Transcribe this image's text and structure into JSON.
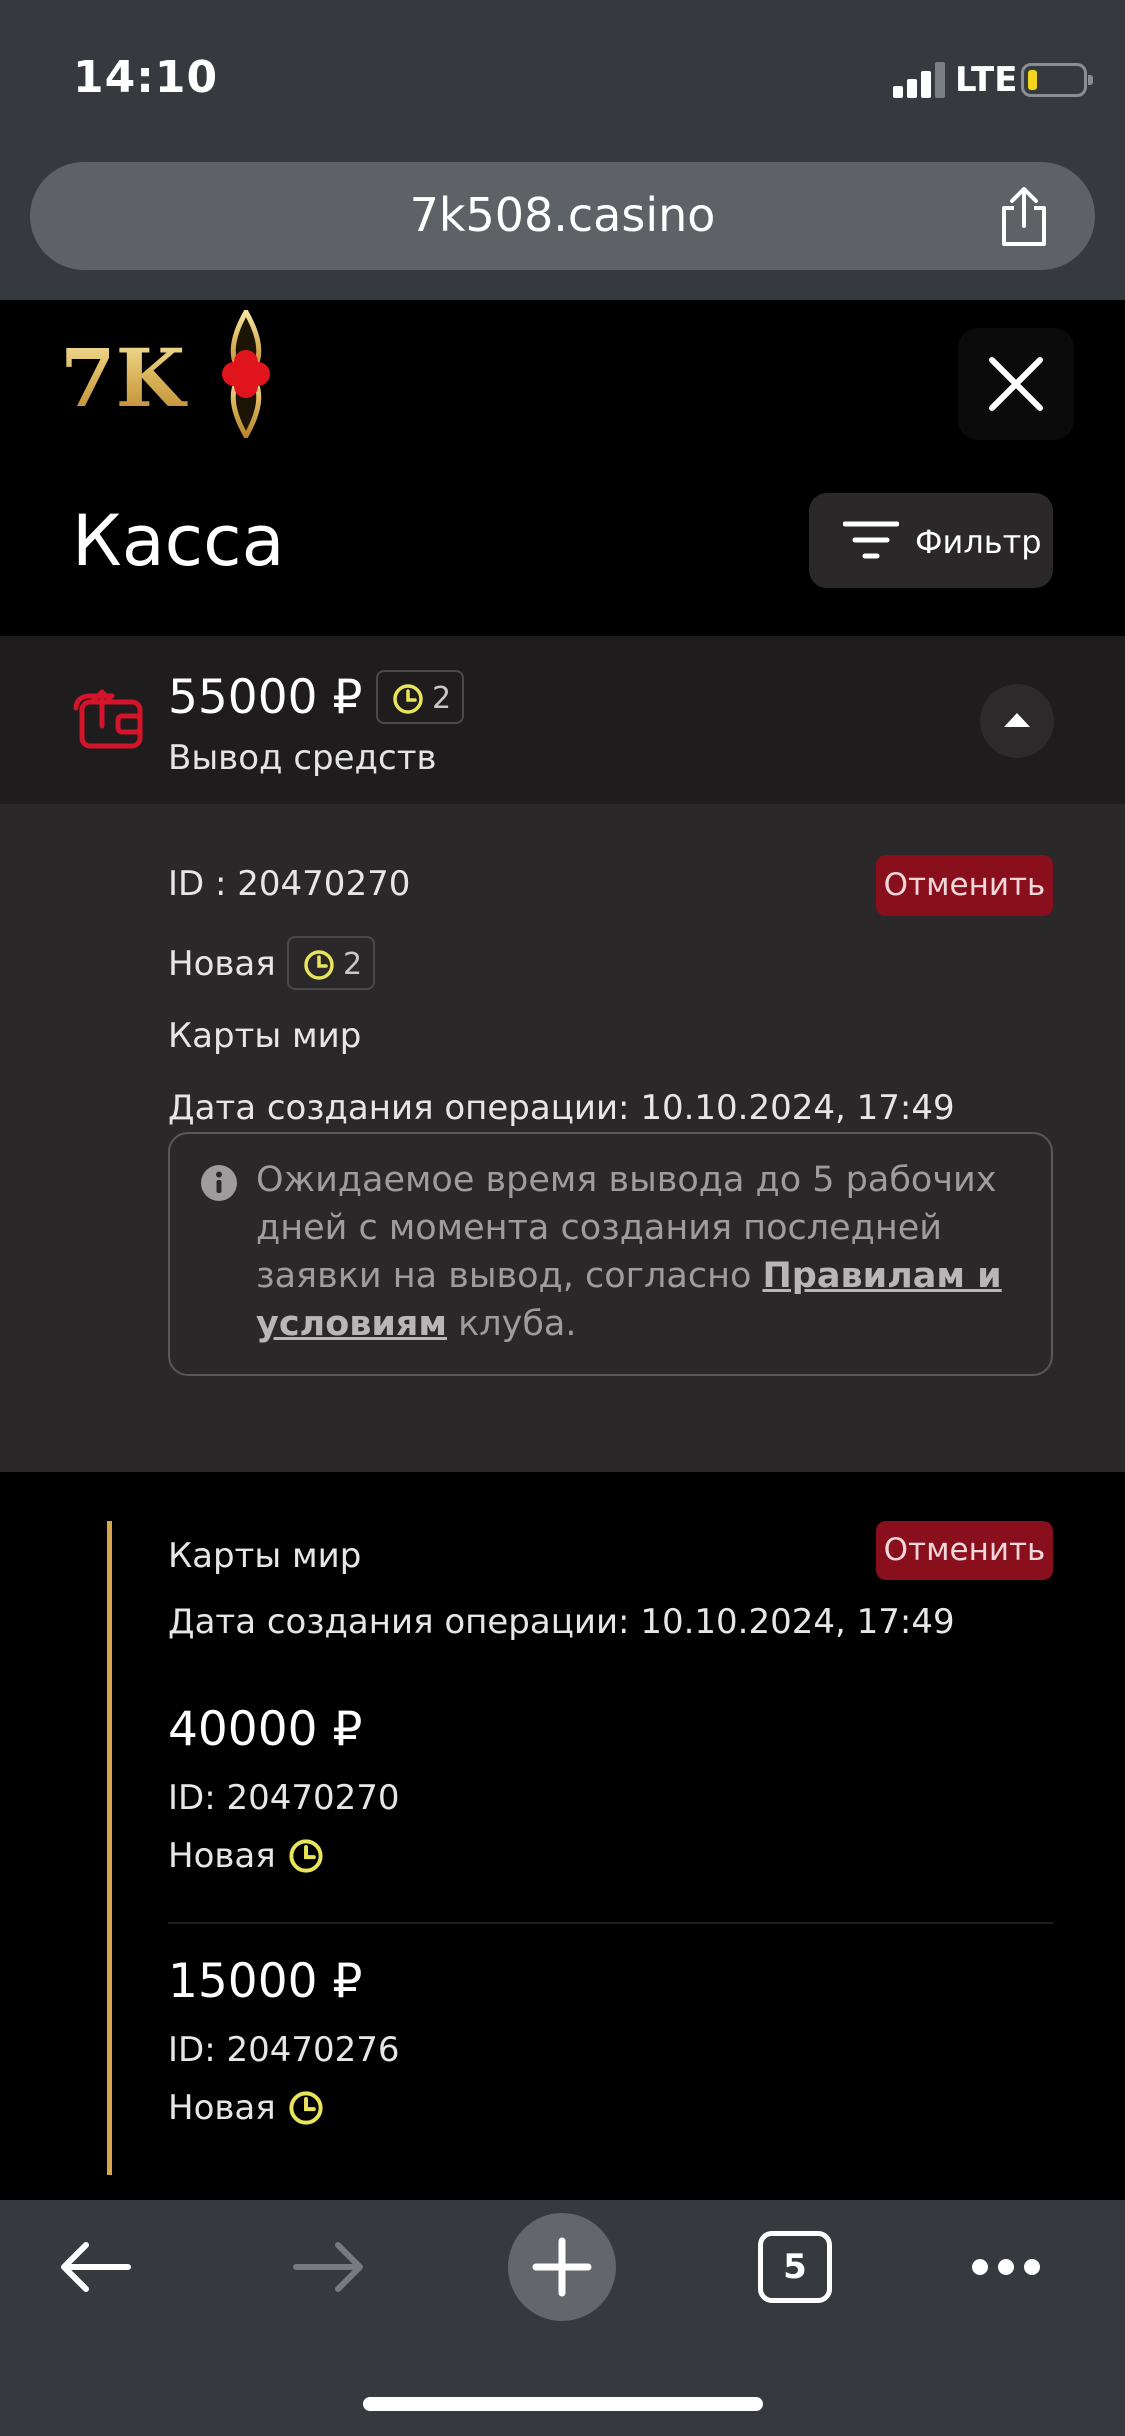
{
  "status_bar": {
    "time": "14:10",
    "network": "LTE"
  },
  "browser": {
    "url": "7k508.casino",
    "tabs_count": "5"
  },
  "header": {
    "logo_text": "7K",
    "title": "Касса",
    "filter_label": "Фильтр"
  },
  "transaction": {
    "amount": "55000 ₽",
    "pending_count": "2",
    "type": "Вывод средств",
    "details": {
      "id": "ID : 20470270",
      "cancel_label": "Отменить",
      "status": "Новая",
      "status_count": "2",
      "method": "Карты мир",
      "created": "Дата создания операции: 10.10.2024, 17:49",
      "info_text_before": "Ожидаемое время вывода до 5 рабочих дней с момента создания последней заявки на вывод, согласно ",
      "info_link": "Правилам и условиям",
      "info_text_after": " клуба."
    },
    "sub_group": {
      "method": "Карты мир",
      "cancel_label": "Отменить",
      "created": "Дата создания операции: 10.10.2024, 17:49",
      "items": [
        {
          "amount": "40000 ₽",
          "id": "ID: 20470270",
          "status": "Новая"
        },
        {
          "amount": "15000 ₽",
          "id": "ID: 20470276",
          "status": "Новая"
        }
      ]
    }
  },
  "colors": {
    "accent_red": "#8a0f1d",
    "gold": "#d6a74a",
    "clock_yellow": "#e9e55a"
  }
}
